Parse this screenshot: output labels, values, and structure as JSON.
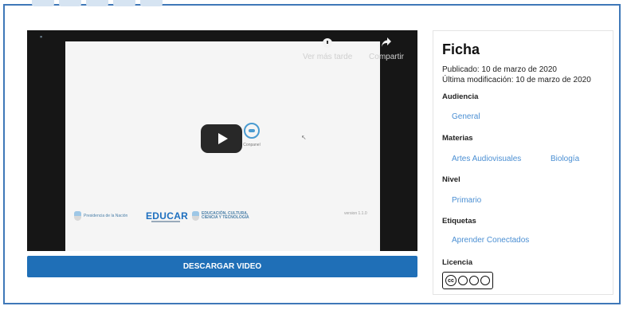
{
  "video": {
    "watch_later_label": "Ver más tarde",
    "share_label": "Compartir",
    "channel_name": "Conpanel",
    "gobierno_text": "Presidencia de la Nación",
    "educar_logo": "EDUCAR",
    "ministerio_text": "EDUCACIÓN, CULTURA, CIENCIA Y TECNOLOGÍA",
    "version": "version 1.1.0"
  },
  "download_button": "DESCARGAR VIDEO",
  "ficha": {
    "title": "Ficha",
    "published": "Publicado: 10 de marzo de 2020",
    "modified": "Última modificación: 10 de marzo de 2020",
    "audiencia_label": "Audiencia",
    "audiencia": "General",
    "materias_label": "Materias",
    "materias": [
      "Artes Audiovisuales",
      "Biología"
    ],
    "nivel_label": "Nivel",
    "nivel": "Primario",
    "etiquetas_label": "Etiquetas",
    "etiquetas": "Aprender Conectados",
    "licencia_label": "Licencia"
  },
  "colors": {
    "accent": "#1f6fb7",
    "link": "#4b8fd3",
    "frame": "#3f78b8"
  }
}
